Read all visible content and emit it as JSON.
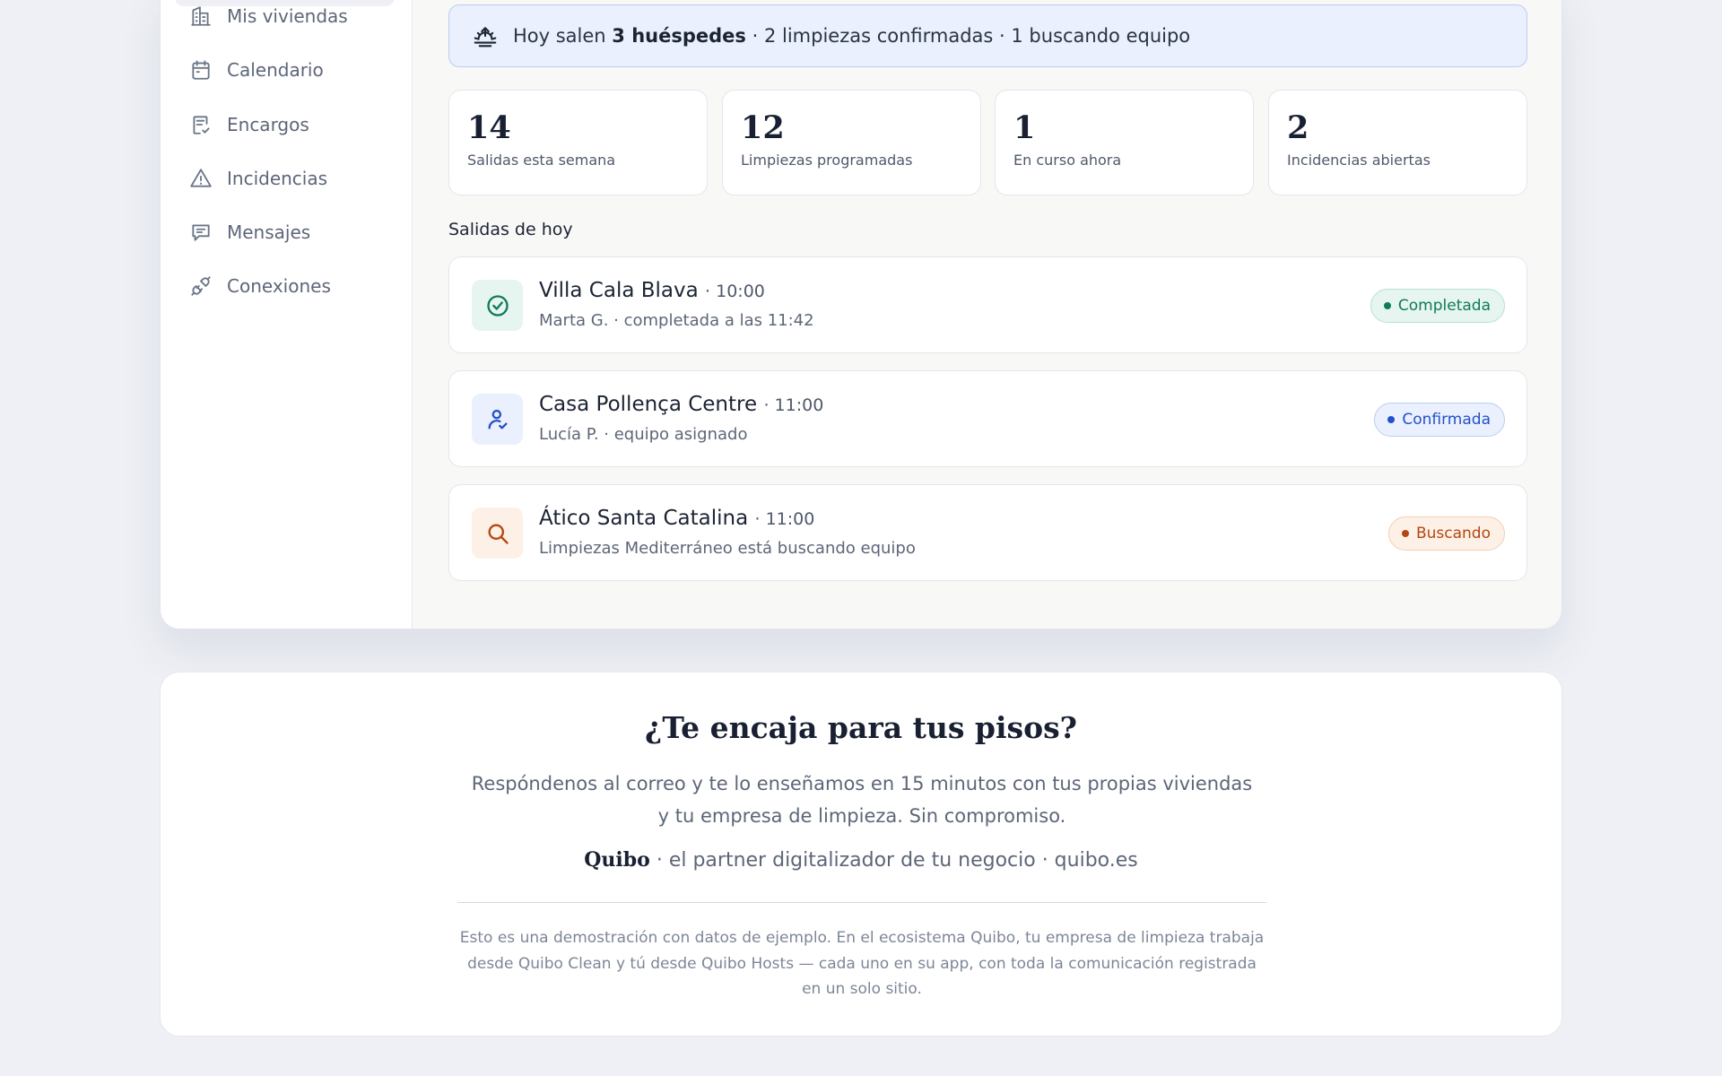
{
  "sidebar": {
    "items": [
      {
        "label": "Mis viviendas",
        "icon": "building-icon"
      },
      {
        "label": "Calendario",
        "icon": "calendar-icon"
      },
      {
        "label": "Encargos",
        "icon": "clipboard-check-icon"
      },
      {
        "label": "Incidencias",
        "icon": "warning-icon"
      },
      {
        "label": "Mensajes",
        "icon": "message-icon"
      },
      {
        "label": "Conexiones",
        "icon": "plug-icon"
      }
    ]
  },
  "banner": {
    "prefix": "Hoy salen ",
    "guests": "3 huéspedes",
    "suffix": " · 2 limpiezas confirmadas · 1 buscando equipo",
    "icon": "sunset-icon"
  },
  "stats": [
    {
      "value": "14",
      "label": "Salidas esta semana"
    },
    {
      "value": "12",
      "label": "Limpiezas programadas"
    },
    {
      "value": "1",
      "label": "En curso ahora"
    },
    {
      "value": "2",
      "label": "Incidencias abiertas"
    }
  ],
  "departures": {
    "title": "Salidas de hoy",
    "rows": [
      {
        "name": "Villa Cala Blava",
        "time": "· 10:00",
        "detail": "Marta G. · completada a las 11:42",
        "status": "Completada",
        "icon": "check-circle-icon",
        "color": "#0f7a5c",
        "bg": "#e6f5ef"
      },
      {
        "name": "Casa Pollença Centre",
        "time": "· 11:00",
        "detail": "Lucía P. · equipo asignado",
        "status": "Confirmada",
        "icon": "user-check-icon",
        "color": "#2450c9",
        "bg": "#eaf0fd"
      },
      {
        "name": "Ático Santa Catalina",
        "time": "· 11:00",
        "detail": "Limpiezas Mediterráneo está buscando equipo",
        "status": "Buscando",
        "icon": "search-icon",
        "color": "#b3470f",
        "bg": "#fdf0e6"
      }
    ]
  },
  "cta": {
    "title": "¿Te encaja para tus pisos?",
    "description": "Respóndenos al correo y te lo enseñamos en 15 minutos con tus propias viviendas y tu empresa de limpieza. Sin compromiso.",
    "brand": "Quibo",
    "tagline": " · el partner digitalizador de tu negocio · quibo.es",
    "note": "Esto es una demostración con datos de ejemplo. En el ecosistema Quibo, tu empresa de limpieza trabaja desde Quibo Clean y tú desde Quibo Hosts — cada uno en su app, con toda la comunicación registrada en un solo sitio."
  }
}
